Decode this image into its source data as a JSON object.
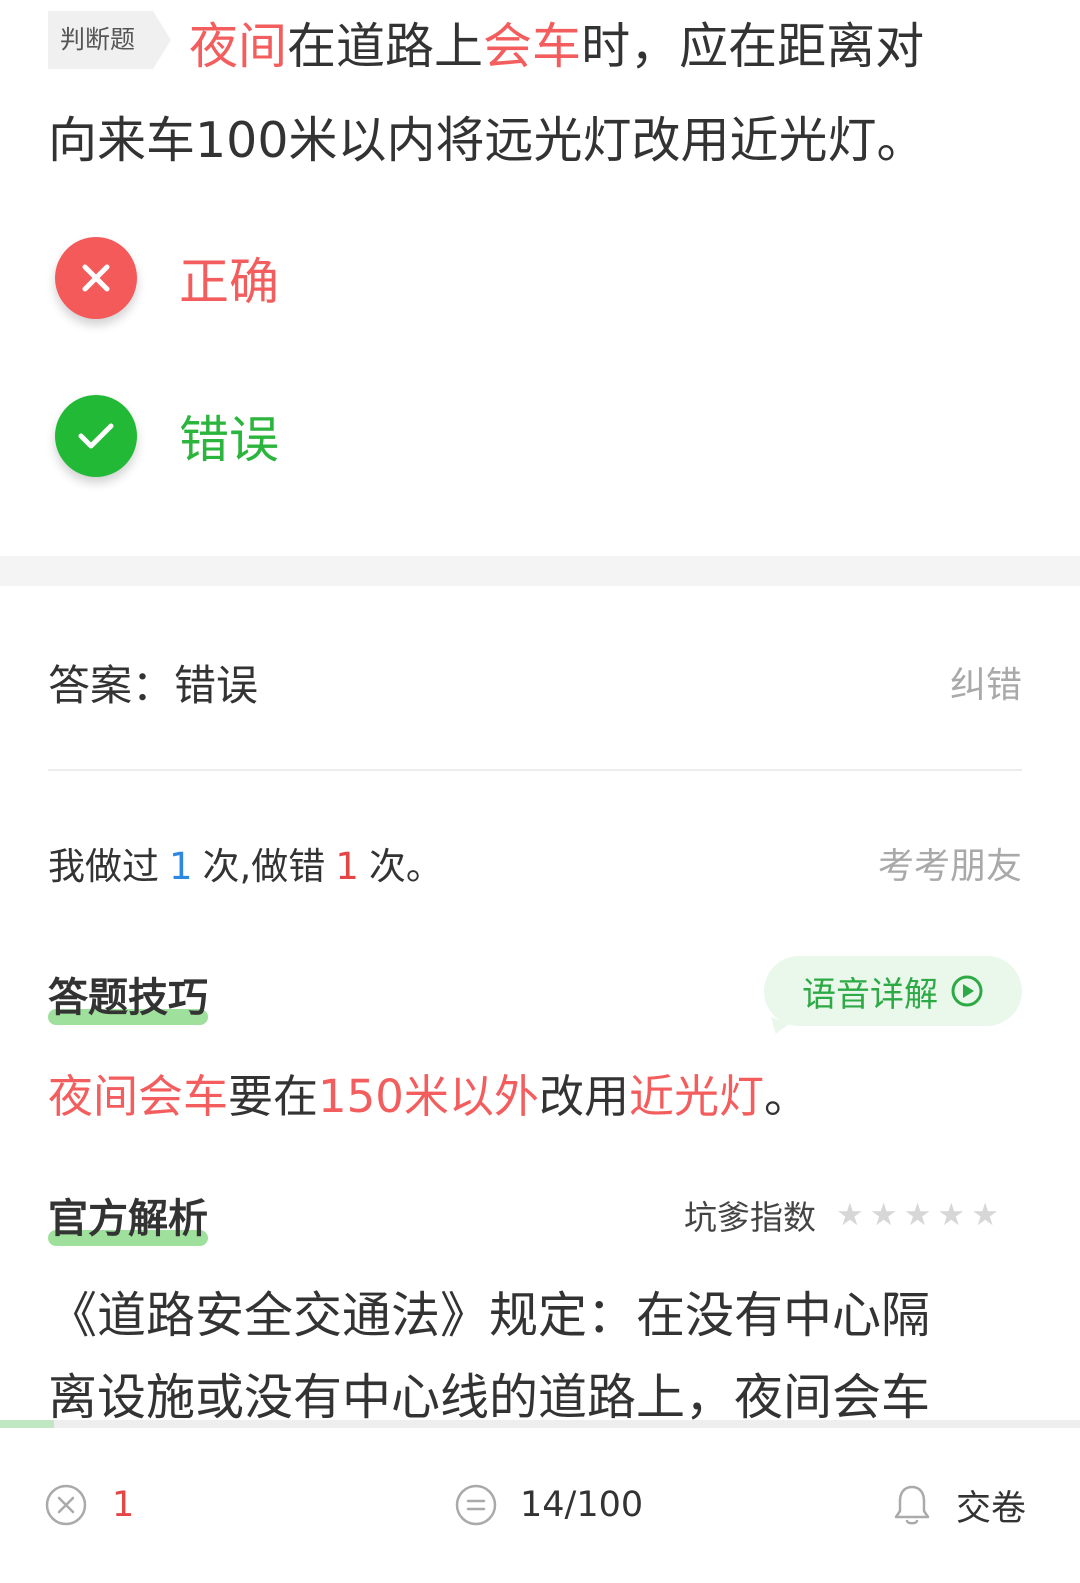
{
  "question": {
    "type_badge": "判断题",
    "line1": [
      {
        "text": "夜间",
        "hl": true
      },
      {
        "text": "在道路上",
        "hl": false
      },
      {
        "text": "会车",
        "hl": true
      },
      {
        "text": "时，应在距离对",
        "hl": false
      }
    ],
    "line2": "向来车100米以内将远光灯改用近光灯。"
  },
  "options": [
    {
      "label": "正确",
      "state": "selected-wrong",
      "icon": "x-icon"
    },
    {
      "label": "错误",
      "state": "correct",
      "icon": "check-icon"
    }
  ],
  "answer": {
    "label": "答案：错误",
    "report_link": "纠错"
  },
  "stats": {
    "prefix": "我做过",
    "done": "1",
    "middle": "次,做错",
    "wrong": "1",
    "suffix": "次。",
    "share_link": "考考朋友"
  },
  "tips": {
    "title": "答题技巧",
    "voice_button": "语音详解",
    "segments": [
      {
        "text": "夜间会车",
        "hl": true
      },
      {
        "text": "要在",
        "hl": false
      },
      {
        "text": "150米以外",
        "hl": true
      },
      {
        "text": "改用",
        "hl": false
      },
      {
        "text": "近光灯",
        "hl": true
      },
      {
        "text": "。",
        "hl": false
      }
    ]
  },
  "official": {
    "title": "官方解析",
    "difficulty_label": "坑爹指数",
    "difficulty_stars": 0,
    "difficulty_max": 5,
    "lines": [
      "《道路安全交通法》规定：在没有中心隔",
      "离设施或没有中心线的道路上，夜间会车"
    ]
  },
  "bottom_bar": {
    "wrong_count": "1",
    "progress_text": "14/100",
    "progress_fraction": 0.05,
    "submit_label": "交卷"
  },
  "colors": {
    "highlight": "#f35d5d",
    "correct": "#21b935",
    "wrong": "#f55a5a",
    "accent_blue": "#2c88e0"
  }
}
